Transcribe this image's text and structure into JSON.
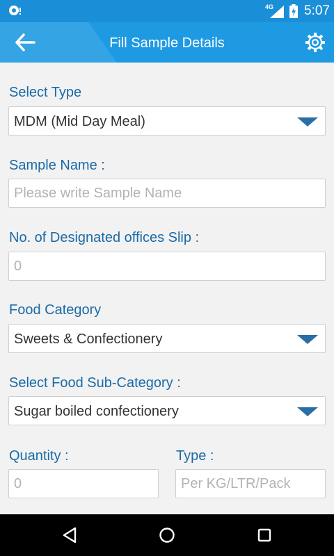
{
  "status_bar": {
    "network": "4G",
    "time": "5:07"
  },
  "header": {
    "title": "Fill Sample Details"
  },
  "form": {
    "select_type_label": "Select Type",
    "select_type_value": "MDM (Mid Day Meal)",
    "sample_name_label": "Sample Name :",
    "sample_name_placeholder": "Please write Sample Name",
    "slip_label": "No. of Designated offices Slip :",
    "slip_placeholder": "0",
    "food_category_label": "Food Category",
    "food_category_value": "Sweets & Confectionery",
    "sub_category_label": "Select Food Sub-Category :",
    "sub_category_value": "Sugar boiled confectionery",
    "quantity_label": "Quantity :",
    "quantity_placeholder": "0",
    "unit_type_label": "Type :",
    "unit_type_placeholder": "Per KG/LTR/Pack"
  },
  "colors": {
    "status_bar": "#1a8fd8",
    "app_bar": "#1e9ae3",
    "label": "#1a6aa7",
    "dropdown_caret": "#2a6ea6"
  },
  "icons": {
    "back": "arrow-left-icon",
    "settings": "gear-icon",
    "nav_back": "triangle-back-icon",
    "nav_home": "circle-home-icon",
    "nav_recents": "square-recents-icon"
  }
}
